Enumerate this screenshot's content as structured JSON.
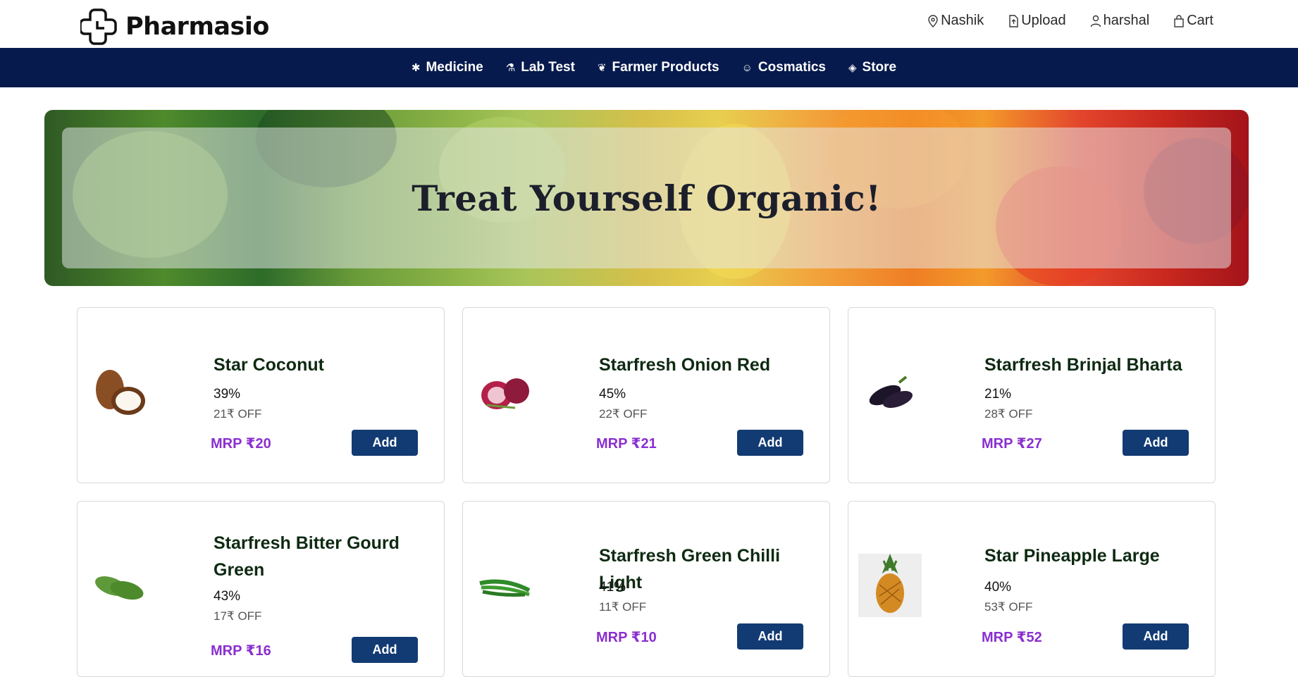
{
  "brand": {
    "name": "Pharmasio"
  },
  "top_links": [
    {
      "label": "Nashik",
      "icon": "location-pin-icon"
    },
    {
      "label": "Upload",
      "icon": "file-upload-icon"
    },
    {
      "label": "harshal",
      "icon": "user-icon"
    },
    {
      "label": "Cart",
      "icon": "shopping-bag-icon"
    }
  ],
  "nav": [
    {
      "label": "Medicine",
      "icon": "pills-icon"
    },
    {
      "label": "Lab Test",
      "icon": "microscope-icon"
    },
    {
      "label": "Farmer Products",
      "icon": "leaf-bowl-icon"
    },
    {
      "label": "Cosmatics",
      "icon": "face-icon"
    },
    {
      "label": "Store",
      "icon": "store-locator-icon"
    }
  ],
  "banner": {
    "title": "Treat Yourself Organic!"
  },
  "products": [
    {
      "name": "Star Coconut",
      "percent": "39%",
      "off": "21₹ OFF",
      "mrp": "MRP ₹20",
      "add_label": "Add",
      "image": "coconut"
    },
    {
      "name": "Starfresh Onion Red",
      "percent": "45%",
      "off": "22₹ OFF",
      "mrp": "MRP ₹21",
      "add_label": "Add",
      "image": "onion"
    },
    {
      "name": "Starfresh Brinjal Bharta",
      "percent": "21%",
      "off": "28₹ OFF",
      "mrp": "MRP ₹27",
      "add_label": "Add",
      "image": "brinjal"
    },
    {
      "name": "Starfresh Bitter Gourd Green",
      "percent": "43%",
      "off": "17₹ OFF",
      "mrp": "MRP ₹16",
      "add_label": "Add",
      "image": "bitter-gourd"
    },
    {
      "name": "Starfresh Green Chilli Light",
      "percent": "41%",
      "off": "11₹ OFF",
      "mrp": "MRP ₹10",
      "add_label": "Add",
      "image": "green-chilli"
    },
    {
      "name": "Star Pineapple Large",
      "percent": "40%",
      "off": "53₹ OFF",
      "mrp": "MRP ₹52",
      "add_label": "Add",
      "image": "pineapple"
    }
  ],
  "colors": {
    "navbar": "#061a4d",
    "add_button": "#123b73",
    "mrp": "#8a2fcf"
  }
}
